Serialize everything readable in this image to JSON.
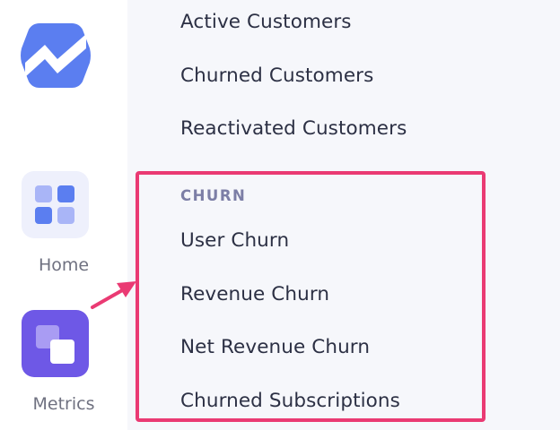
{
  "sidebar": {
    "logo_icon": "baremetrics-logo-icon",
    "items": [
      {
        "label": "Home",
        "icon": "dashboard-grid-icon",
        "active": false
      },
      {
        "label": "Metrics",
        "icon": "metrics-squares-icon",
        "active": true
      }
    ]
  },
  "menu": {
    "top_items": [
      {
        "label": "Active Customers"
      },
      {
        "label": "Churned Customers"
      },
      {
        "label": "Reactivated Customers"
      }
    ],
    "churn_section": {
      "title": "CHURN",
      "items": [
        {
          "label": "User Churn"
        },
        {
          "label": "Revenue Churn"
        },
        {
          "label": "Net Revenue Churn"
        },
        {
          "label": "Churned Subscriptions"
        }
      ]
    }
  },
  "colors": {
    "accent": "#6e58e6",
    "logo": "#5b7ef0",
    "highlight": "#ea3a73",
    "text": "#2c3044",
    "section_title": "#7c7ea6"
  }
}
